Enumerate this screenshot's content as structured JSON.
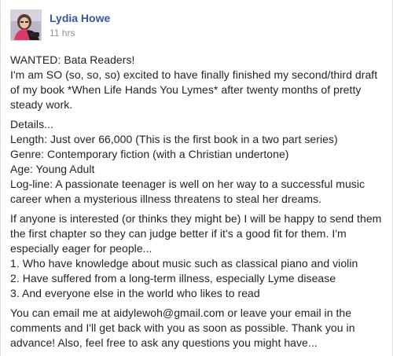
{
  "post": {
    "author": "Lydia Howe",
    "timestamp": "11 hrs",
    "avatar_icon": "profile-photo",
    "colors": {
      "author_link": "#365899",
      "timestamp": "#90949c",
      "body_text": "#1d2129"
    },
    "paragraphs": [
      [
        "WANTED: Bata Readers!",
        "I'm am SO (so, so, so) excited to have finally finished my second/third draft",
        "of my book *When Life Hands You Lymes* after twenty months of pretty",
        "steady work."
      ],
      [
        "Details...",
        "Length: Just over 66,000 (This is the first book in a two part series)",
        "Genre: Contemporary fiction (with a Christian undertone)",
        "Age: Young Adult",
        "Log-line: A passionate teenager is well on her way to a successful music",
        "career when a mysterious illness threatens to steal her dreams."
      ],
      [
        "If anyone is interested (or thinks they might be) I will be happy to send them",
        "the first chapter so they can judge better if it's a good fit for them. I'm",
        "especially eager for people...",
        "1. Who have knowledge about music such as classical piano and violin",
        "2. Have suffered from a long-term illness, especially Lyme disease",
        "3. And everyone else in the world who likes to read"
      ],
      [
        "You can email me at aidylewoh@gmail.com or leave your email in the",
        "comments and I'll get back with you as soon as possible. Thank you in",
        "advance! Also, feel free to ask any questions you might have..."
      ]
    ]
  }
}
